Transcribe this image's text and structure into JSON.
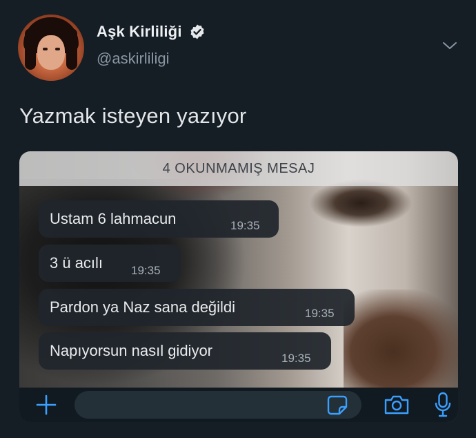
{
  "tweet": {
    "display_name": "Aşk Kirliliği",
    "handle": "@askirliligi",
    "verified": true,
    "text": "Yazmak isteyen yazıyor"
  },
  "media": {
    "unread_banner": "4 OKUNMAMIŞ MESAJ",
    "messages": [
      {
        "text": "Ustam 6 lahmacun",
        "time": "19:35"
      },
      {
        "text": "3 ü acılı",
        "time": "19:35"
      },
      {
        "text": "Pardon ya Naz sana değildi",
        "time": "19:35"
      },
      {
        "text": "Napıyorsun nasıl gidiyor",
        "time": "19:35"
      }
    ],
    "input_bar_icons": [
      "plus-icon",
      "sticker-icon",
      "camera-icon",
      "microphone-icon"
    ]
  },
  "colors": {
    "background": "#151d25",
    "accent_blue": "#3aa0ff",
    "verified_badge": "#e6e9ec"
  }
}
